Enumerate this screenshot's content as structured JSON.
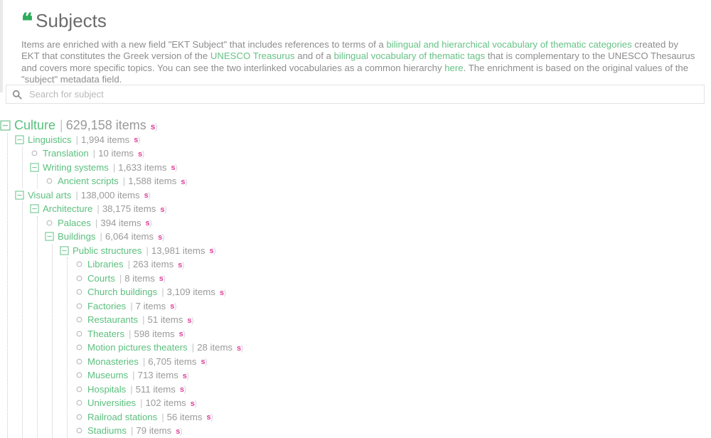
{
  "header": {
    "quote_icon": "❝",
    "title": "Subjects",
    "description_parts": [
      {
        "type": "text",
        "text": "Items are enriched with a new field \"EKT Subject\" that includes references to terms of a "
      },
      {
        "type": "link",
        "text": "bilingual and hierarchical vocabulary of thematic categories"
      },
      {
        "type": "text",
        "text": " created by EKT that constitutes the Greek version of the "
      },
      {
        "type": "link",
        "text": "UNESCO Treasurus"
      },
      {
        "type": "text",
        "text": " and of a "
      },
      {
        "type": "link",
        "text": "bilingual vocabulary of thematic tags"
      },
      {
        "type": "text",
        "text": " that is complementary to the UNESCO Thesaurus and covers more specific topics. You can see the two interlinked vocabularies as a common hierarchy "
      },
      {
        "type": "link",
        "text": "here"
      },
      {
        "type": "text",
        "text": ". The enrichment is based on the original values of the \"subject\" metadata field."
      }
    ]
  },
  "search": {
    "icon": "search-icon",
    "placeholder": "Search for subject",
    "value": ""
  },
  "colors": {
    "link": "#66c286",
    "tree_label": "#5cbf7e",
    "count": "#9a9a9a",
    "badge": "#e0409a",
    "toggle": "#7fcb9b",
    "bullet": "#b9b9b9",
    "accent_green": "#2dab5b"
  },
  "tree": {
    "items_word": "items",
    "badge_label": "s)",
    "nodes": [
      {
        "label": "Culture",
        "count": "629,158",
        "expandable": true,
        "expanded": true,
        "level": 0,
        "children": [
          {
            "label": "Linguistics",
            "count": "1,994",
            "expandable": true,
            "expanded": true,
            "level": 1,
            "children": [
              {
                "label": "Translation",
                "count": "10",
                "expandable": false,
                "level": 2,
                "children": []
              },
              {
                "label": "Writing systems",
                "count": "1,633",
                "expandable": true,
                "expanded": true,
                "level": 2,
                "children": [
                  {
                    "label": "Ancient scripts",
                    "count": "1,588",
                    "expandable": false,
                    "level": 3,
                    "children": []
                  }
                ]
              }
            ]
          },
          {
            "label": "Visual arts",
            "count": "138,000",
            "expandable": true,
            "expanded": true,
            "level": 1,
            "children": [
              {
                "label": "Architecture",
                "count": "38,175",
                "expandable": true,
                "expanded": true,
                "level": 2,
                "children": [
                  {
                    "label": "Palaces",
                    "count": "394",
                    "expandable": false,
                    "level": 3,
                    "children": []
                  },
                  {
                    "label": "Buildings",
                    "count": "6,064",
                    "expandable": true,
                    "expanded": true,
                    "level": 3,
                    "children": [
                      {
                        "label": "Public structures",
                        "count": "13,981",
                        "expandable": true,
                        "expanded": true,
                        "level": 4,
                        "children": [
                          {
                            "label": "Libraries",
                            "count": "263",
                            "expandable": false,
                            "level": 5,
                            "children": []
                          },
                          {
                            "label": "Courts",
                            "count": "8",
                            "expandable": false,
                            "level": 5,
                            "children": []
                          },
                          {
                            "label": "Church buildings",
                            "count": "3,109",
                            "expandable": false,
                            "level": 5,
                            "children": []
                          },
                          {
                            "label": "Factories",
                            "count": "7",
                            "expandable": false,
                            "level": 5,
                            "children": []
                          },
                          {
                            "label": "Restaurants",
                            "count": "51",
                            "expandable": false,
                            "level": 5,
                            "children": []
                          },
                          {
                            "label": "Theaters",
                            "count": "598",
                            "expandable": false,
                            "level": 5,
                            "children": []
                          },
                          {
                            "label": "Motion pictures theaters",
                            "count": "28",
                            "expandable": false,
                            "level": 5,
                            "children": []
                          },
                          {
                            "label": "Monasteries",
                            "count": "6,705",
                            "expandable": false,
                            "level": 5,
                            "children": []
                          },
                          {
                            "label": "Museums",
                            "count": "713",
                            "expandable": false,
                            "level": 5,
                            "children": []
                          },
                          {
                            "label": "Hospitals",
                            "count": "511",
                            "expandable": false,
                            "level": 5,
                            "children": []
                          },
                          {
                            "label": "Universities",
                            "count": "102",
                            "expandable": false,
                            "level": 5,
                            "children": []
                          },
                          {
                            "label": "Railroad stations",
                            "count": "56",
                            "expandable": false,
                            "level": 5,
                            "children": []
                          },
                          {
                            "label": "Stadiums",
                            "count": "79",
                            "expandable": false,
                            "level": 5,
                            "children": []
                          }
                        ]
                      }
                    ]
                  }
                ]
              }
            ]
          }
        ]
      }
    ]
  }
}
